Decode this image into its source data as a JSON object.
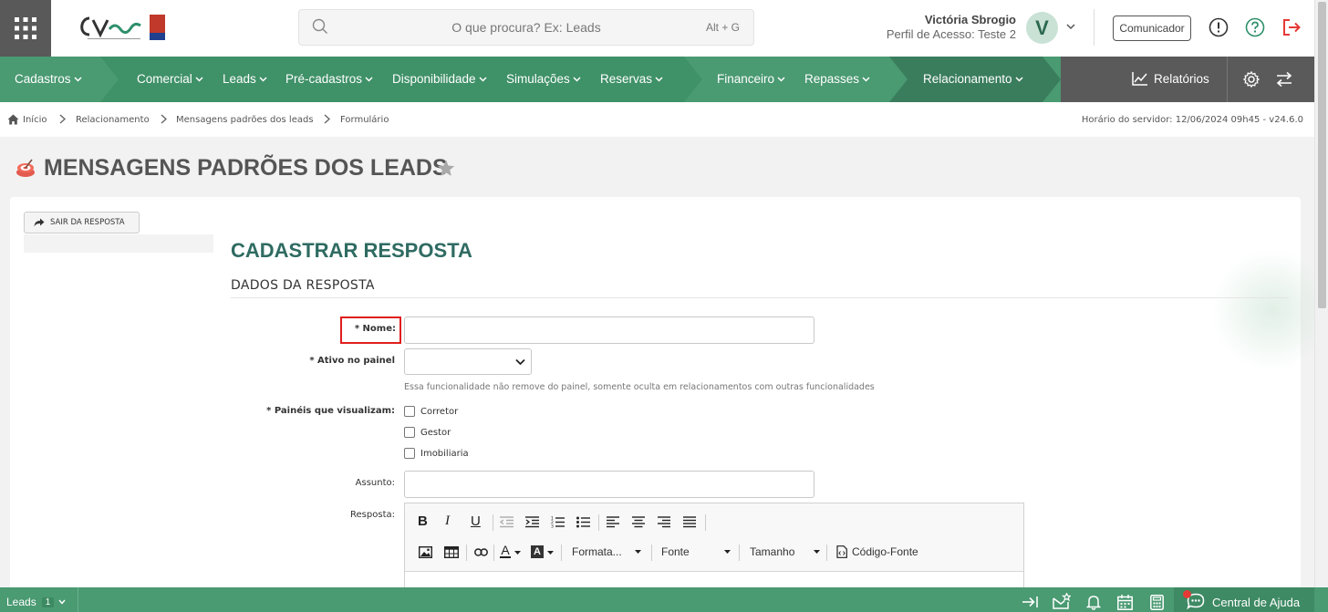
{
  "header": {
    "search_placeholder": "O que procura? Ex: Leads",
    "search_shortcut": "Alt + G",
    "user_name": "Victória Sbrogio",
    "user_profile": "Perfil de Acesso: Teste 2",
    "avatar_initial": "V",
    "communicator_label": "Comunicador"
  },
  "nav": {
    "items": [
      {
        "label": "Cadastros"
      },
      {
        "label": "Comercial"
      },
      {
        "label": "Leads"
      },
      {
        "label": "Pré-cadastros"
      },
      {
        "label": "Disponibilidade"
      },
      {
        "label": "Simulações"
      },
      {
        "label": "Reservas"
      },
      {
        "label": "Financeiro"
      },
      {
        "label": "Repasses"
      },
      {
        "label": "Relacionamento"
      }
    ],
    "reports_label": "Relatórios"
  },
  "breadcrumb": {
    "items": [
      "Início",
      "Relacionamento",
      "Mensagens padrões dos leads",
      "Formulário"
    ],
    "server_time": "Horário do servidor: 12/06/2024 09h45 - v24.6.0"
  },
  "page": {
    "title": "MENSAGENS PADRÕES DOS LEADS",
    "exit_button": "SAIR DA RESPOSTA",
    "form_title": "CADASTRAR RESPOSTA",
    "section_title": "DADOS DA RESPOSTA"
  },
  "form": {
    "name_label": "* Nome:",
    "name_value": "",
    "active_label": "* Ativo no painel",
    "active_value": "",
    "active_hint": "Essa funcionalidade não remove do painel, somente oculta em relacionamentos com outras funcionalidades",
    "panels_label": "* Painéis que visualizam:",
    "panels": [
      {
        "label": "Corretor",
        "checked": false
      },
      {
        "label": "Gestor",
        "checked": false
      },
      {
        "label": "Imobiliaria",
        "checked": false
      }
    ],
    "subject_label": "Assunto:",
    "subject_value": "",
    "answer_label": "Resposta:"
  },
  "editor": {
    "format_label": "Formata...",
    "font_label": "Fonte",
    "size_label": "Tamanho",
    "source_label": "Código-Fonte"
  },
  "bottombar": {
    "leads_label": "Leads",
    "leads_count": "1",
    "help_label": "Central de Ajuda"
  },
  "colors": {
    "nav_green": "#4a9a72",
    "title_teal": "#2f6b62",
    "highlight_red": "#e01e1e"
  }
}
